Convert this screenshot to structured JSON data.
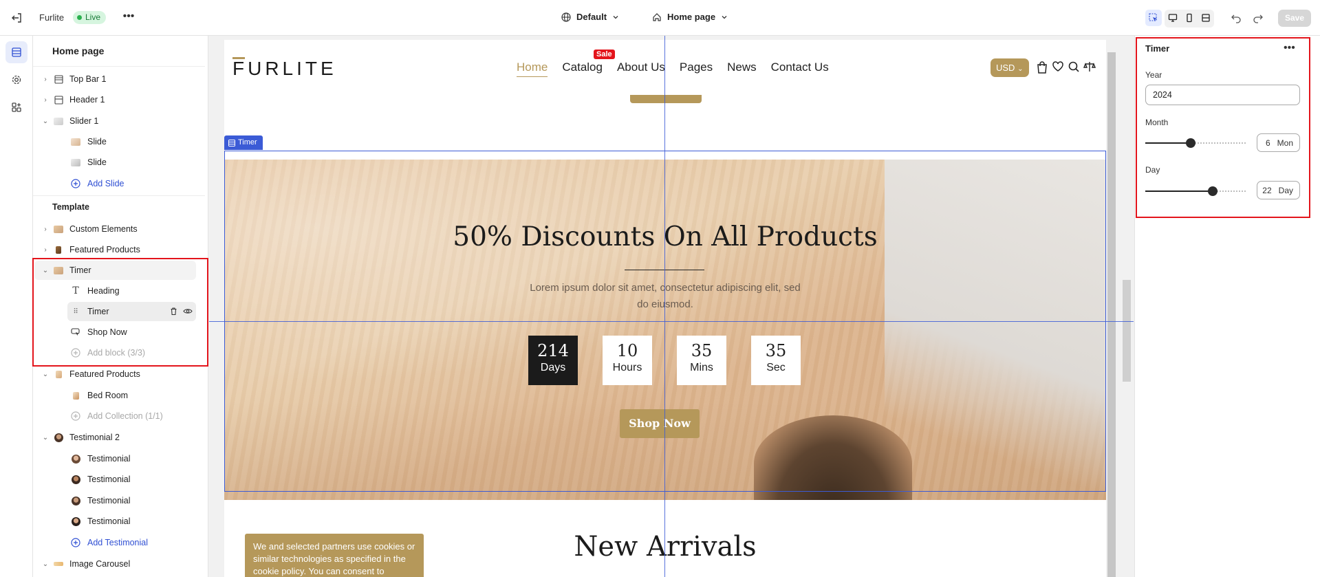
{
  "topbar": {
    "store_name": "Furlite",
    "live_label": "Live",
    "theme_label": "Default",
    "page_label": "Home page",
    "save_label": "Save"
  },
  "sidebar": {
    "title": "Home page",
    "template_heading": "Template",
    "rows": [
      {
        "label": "Top Bar 1"
      },
      {
        "label": "Header 1"
      },
      {
        "label": "Slider 1"
      },
      {
        "label": "Slide"
      },
      {
        "label": "Slide"
      },
      {
        "label": "Add Slide"
      },
      {
        "label": "Custom Elements"
      },
      {
        "label": "Featured Products"
      },
      {
        "label": "Timer"
      },
      {
        "label": "Heading"
      },
      {
        "label": "Timer"
      },
      {
        "label": "Shop Now"
      },
      {
        "label": "Add block (3/3)"
      },
      {
        "label": "Featured Products"
      },
      {
        "label": "Bed Room"
      },
      {
        "label": "Add Collection (1/1)"
      },
      {
        "label": "Testimonial 2"
      },
      {
        "label": "Testimonial"
      },
      {
        "label": "Testimonial"
      },
      {
        "label": "Testimonial"
      },
      {
        "label": "Testimonial"
      },
      {
        "label": "Add Testimonial"
      },
      {
        "label": "Image Carousel"
      }
    ]
  },
  "site": {
    "logo": "FURLITE",
    "nav": [
      "Home",
      "Catalog",
      "About Us",
      "Pages",
      "News",
      "Contact Us"
    ],
    "sale_badge": "Sale",
    "currency": "USD",
    "selection_tag": "Timer",
    "hero": {
      "title": "50% Discounts On All Products",
      "subtitle": "Lorem ipsum dolor sit amet, consectetur adipiscing elit, sed do eiusmod.",
      "countdown": [
        {
          "value": "214",
          "label": "Days"
        },
        {
          "value": "10",
          "label": "Hours"
        },
        {
          "value": "35",
          "label": "Mins"
        },
        {
          "value": "35",
          "label": "Sec"
        }
      ],
      "button": "Shop Now"
    },
    "next_section_title": "New Arrivals",
    "cookie_text": "We and selected partners use cookies or similar technologies as specified in the cookie policy. You can consent to"
  },
  "panel": {
    "title": "Timer",
    "year_label": "Year",
    "year_value": "2024",
    "month_label": "Month",
    "month_value": "6",
    "month_unit": "Mon",
    "month_fraction": 0.45,
    "day_label": "Day",
    "day_value": "22",
    "day_unit": "Day",
    "day_fraction": 0.67
  },
  "colors": {
    "accent": "#b5985a",
    "selection": "#3b5bd6",
    "highlight": "#e3141b",
    "live_bg": "#d6f5df"
  }
}
